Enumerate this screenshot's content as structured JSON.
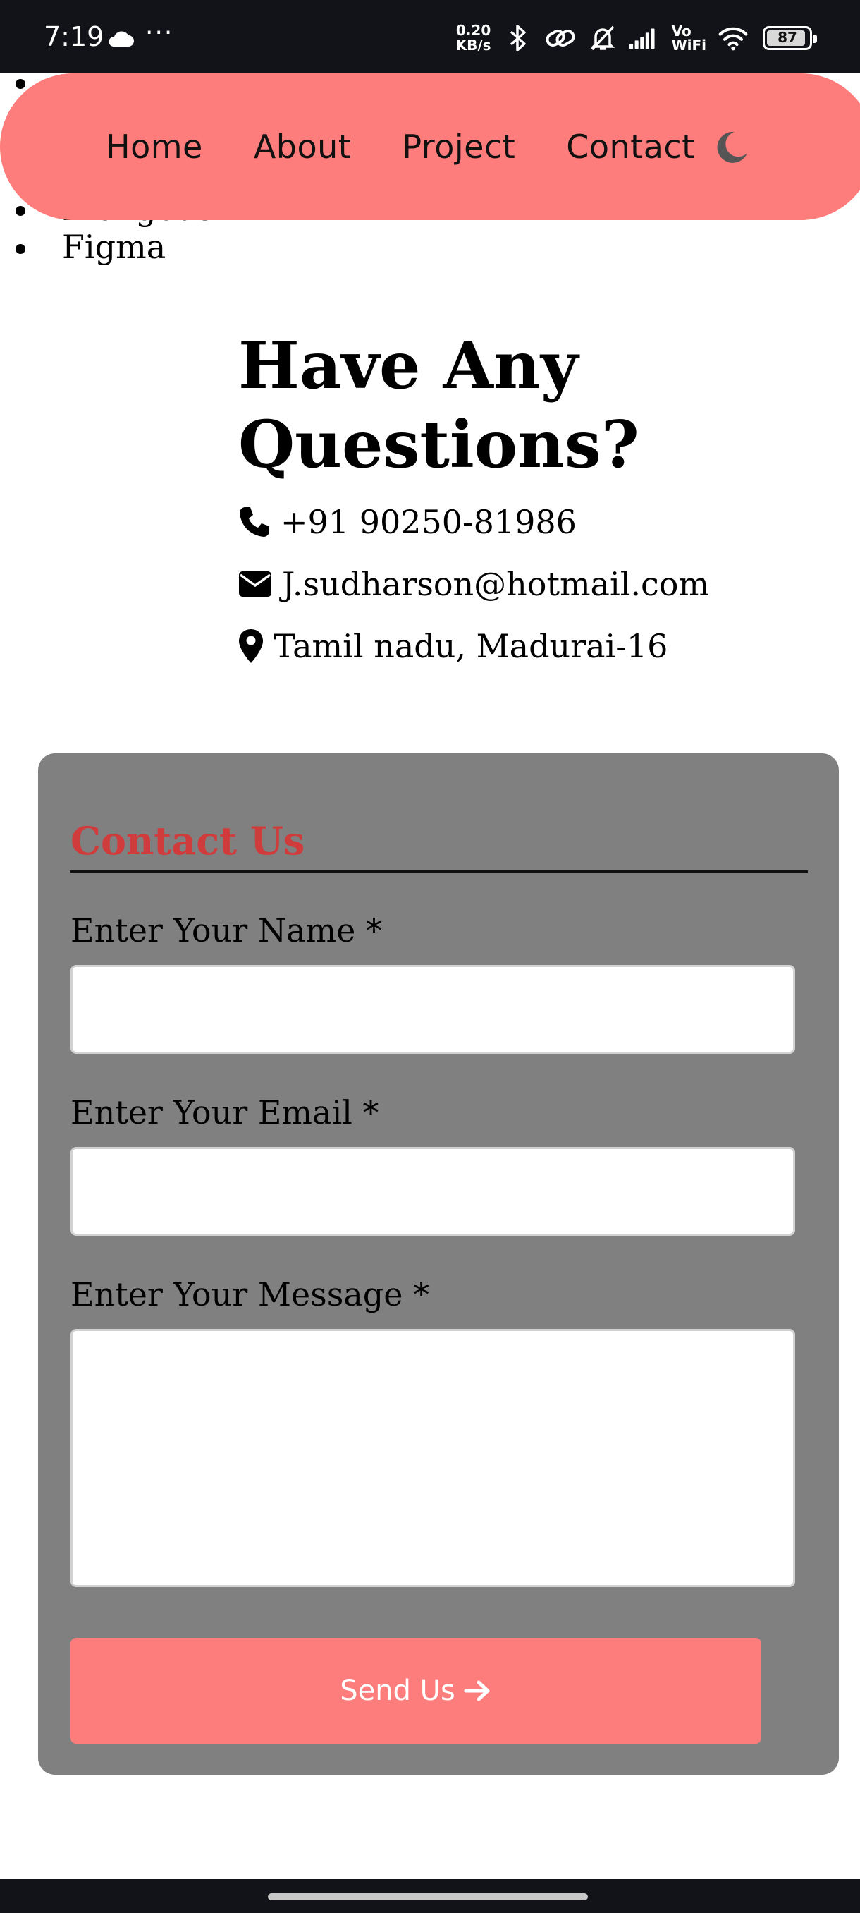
{
  "status_bar": {
    "time": "7:19",
    "dots": "···",
    "net_speed_value": "0.20",
    "net_speed_unit": "KB/s",
    "vowifi_top": "Vo",
    "vowifi_bottom": "WiFi",
    "battery": "87"
  },
  "background_list": {
    "items": [
      "",
      "Mongous",
      "Figma"
    ]
  },
  "nav": {
    "items": [
      "Home",
      "About",
      "Project",
      "Contact"
    ],
    "theme_toggle_icon": "moon-icon",
    "background_color": "#fd7d7c"
  },
  "contact_info": {
    "heading_line1": "Have Any",
    "heading_line2": "Questions?",
    "phone": "+91 90250-81986",
    "email": "J.sudharson@hotmail.com",
    "address": "Tamil nadu, Madurai-16"
  },
  "form": {
    "title": "Contact Us",
    "title_color": "#d03b3b",
    "name_label": "Enter Your Name *",
    "email_label": "Enter Your Email *",
    "message_label": "Enter Your Message *",
    "name_value": "",
    "email_value": "",
    "message_value": "",
    "submit_label": "Send Us",
    "submit_icon": "arrow-right-icon",
    "card_color": "#808080"
  }
}
